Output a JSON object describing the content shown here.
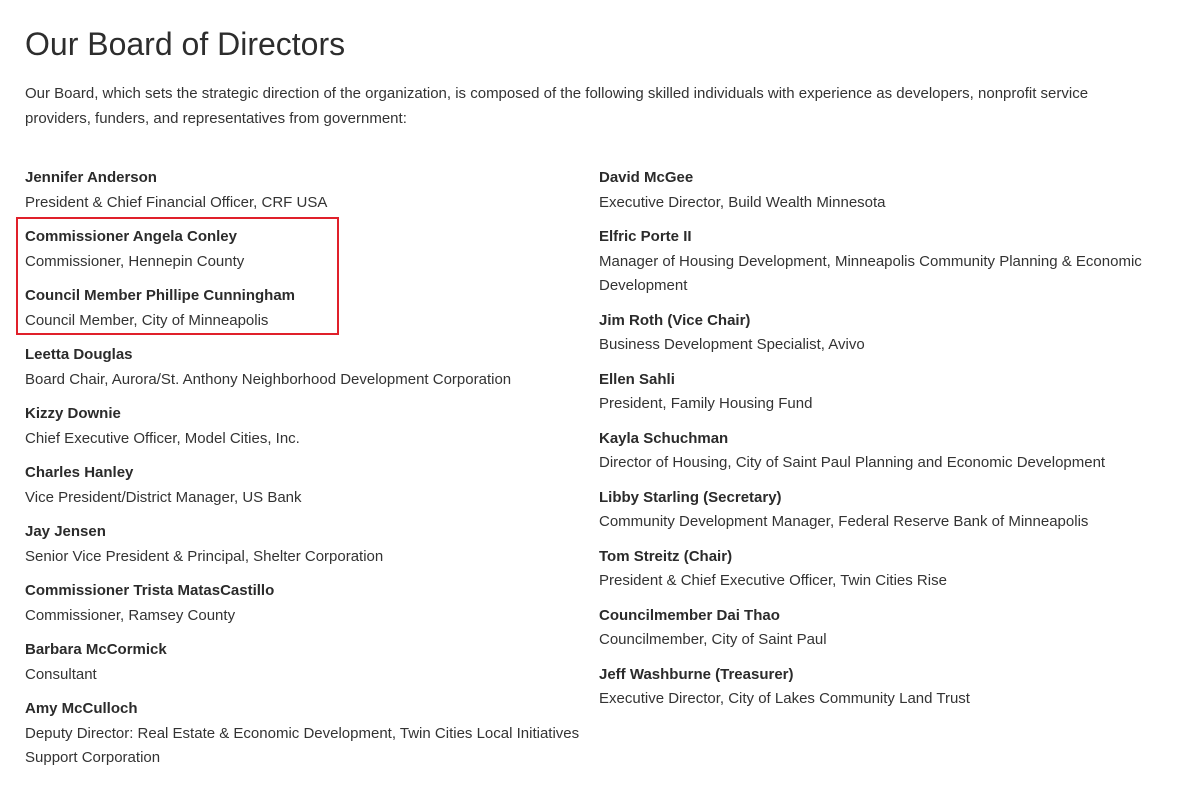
{
  "page": {
    "title": "Our Board of Directors",
    "intro": "Our Board, which sets the strategic direction of the organization, is composed of the following skilled individuals with experience as developers, nonprofit service providers, funders, and representatives from government:"
  },
  "left_members": [
    {
      "name": "Jennifer Anderson",
      "role": "President & Chief Financial Officer, CRF USA"
    },
    {
      "name": "Commissioner Angela Conley",
      "role": "Commissioner, Hennepin County"
    },
    {
      "name": "Council Member Phillipe Cunningham",
      "role": "Council Member, City of Minneapolis"
    },
    {
      "name": "Leetta Douglas",
      "role": "Board Chair, Aurora/St. Anthony Neighborhood Development Corporation"
    },
    {
      "name": "Kizzy Downie",
      "role": "Chief Executive Officer, Model Cities, Inc."
    },
    {
      "name": "Charles Hanley",
      "role": "Vice President/District Manager, US Bank"
    },
    {
      "name": "Jay Jensen",
      "role": "Senior Vice President & Principal, Shelter Corporation"
    },
    {
      "name": "Commissioner Trista MatasCastillo",
      "role": "Commissioner, Ramsey County"
    },
    {
      "name": "Barbara McCormick",
      "role": "Consultant"
    },
    {
      "name": "Amy McCulloch",
      "role": "Deputy Director: Real Estate & Economic Development, Twin Cities Local Initiatives Support Corporation"
    }
  ],
  "right_members": [
    {
      "name": "David McGee",
      "role": "Executive Director, Build Wealth Minnesota"
    },
    {
      "name": "Elfric Porte II",
      "role": "Manager of Housing Development, Minneapolis Community Planning & Economic Development"
    },
    {
      "name": "Jim Roth (Vice Chair)",
      "role": "Business Development Specialist, Avivo"
    },
    {
      "name": "Ellen Sahli",
      "role": "President, Family Housing Fund"
    },
    {
      "name": "Kayla Schuchman",
      "role": "Director of Housing, City of Saint Paul Planning and Economic Development"
    },
    {
      "name": "Libby Starling (Secretary)",
      "role": "Community Development Manager, Federal Reserve Bank of Minneapolis"
    },
    {
      "name": "Tom Streitz (Chair)",
      "role": "President & Chief Executive Officer, Twin Cities Rise"
    },
    {
      "name": "Councilmember Dai Thao",
      "role": "Councilmember, City of Saint Paul"
    },
    {
      "name": "Jeff Washburne (Treasurer)",
      "role": "Executive Director, City of Lakes Community Land Trust"
    }
  ],
  "colors": {
    "highlight": "#e0202a",
    "text": "#2b2b2b"
  }
}
